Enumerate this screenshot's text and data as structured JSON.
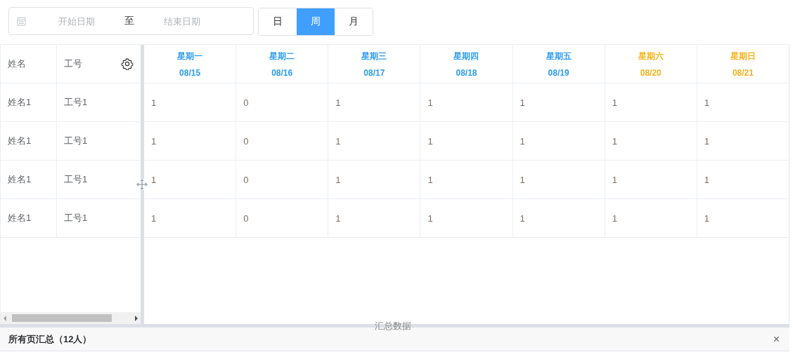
{
  "date_range": {
    "start_placeholder": "开始日期",
    "separator": "至",
    "end_placeholder": "结束日期"
  },
  "period_tabs": [
    {
      "label": "日",
      "selected": false
    },
    {
      "label": "周",
      "selected": true
    },
    {
      "label": "月",
      "selected": false
    }
  ],
  "table": {
    "fixed_columns": [
      "姓名",
      "工号"
    ],
    "day_columns": [
      {
        "weekday": "星期一",
        "date": "08/15",
        "color": "#2d9cf0"
      },
      {
        "weekday": "星期二",
        "date": "08/16",
        "color": "#2d9cf0"
      },
      {
        "weekday": "星期三",
        "date": "08/17",
        "color": "#2d9cf0"
      },
      {
        "weekday": "星期四",
        "date": "08/18",
        "color": "#2d9cf0"
      },
      {
        "weekday": "星期五",
        "date": "08/19",
        "color": "#2d9cf0"
      },
      {
        "weekday": "星期六",
        "date": "08/20",
        "color": "#f5b21b"
      },
      {
        "weekday": "星期日",
        "date": "08/21",
        "color": "#f5b21b"
      }
    ],
    "rows": [
      {
        "name": "姓名1",
        "id": "工号1",
        "values": [
          "1",
          "0",
          "1",
          "1",
          "1",
          "1",
          "1"
        ]
      },
      {
        "name": "姓名1",
        "id": "工号1",
        "values": [
          "1",
          "0",
          "1",
          "1",
          "1",
          "1",
          "1"
        ]
      },
      {
        "name": "姓名1",
        "id": "工号1",
        "values": [
          "1",
          "0",
          "1",
          "1",
          "1",
          "1",
          "1"
        ]
      },
      {
        "name": "姓名1",
        "id": "工号1",
        "values": [
          "1",
          "0",
          "1",
          "1",
          "1",
          "1",
          "1"
        ]
      }
    ]
  },
  "splitter_label": "汇总数据",
  "summary": {
    "title": "所有页汇总（12人）",
    "close": "×"
  }
}
